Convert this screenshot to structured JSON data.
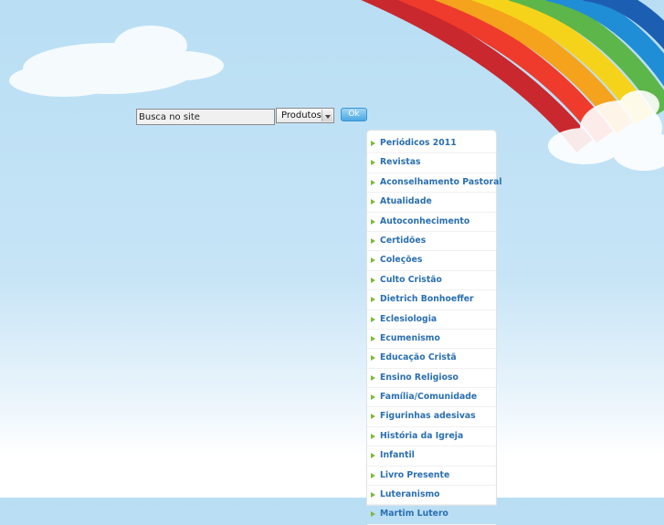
{
  "search": {
    "input_value": "Busca no site",
    "select_value": "Produtos",
    "button_label": "Ok"
  },
  "menu": {
    "items": [
      {
        "label": "Periódicos 2011"
      },
      {
        "label": "Revistas"
      },
      {
        "label": "Aconselhamento Pastoral"
      },
      {
        "label": "Atualidade"
      },
      {
        "label": "Autoconhecimento"
      },
      {
        "label": "Certidões"
      },
      {
        "label": "Coleções"
      },
      {
        "label": "Culto Cristão"
      },
      {
        "label": "Dietrich Bonhoeffer"
      },
      {
        "label": "Eclesiologia"
      },
      {
        "label": "Ecumenismo"
      },
      {
        "label": "Educação Cristã"
      },
      {
        "label": "Ensino Religioso"
      },
      {
        "label": "Família/Comunidade"
      },
      {
        "label": "Figurinhas adesivas"
      },
      {
        "label": "História da Igreja"
      },
      {
        "label": "Infantil"
      },
      {
        "label": "Livro Presente"
      },
      {
        "label": "Luteranismo"
      },
      {
        "label": "Martim Lutero"
      }
    ]
  },
  "colors": {
    "sky": "#b9def4",
    "menu_text": "#2a6fb0",
    "bullet": "#7fb83a",
    "button": "#4aa8e4"
  }
}
